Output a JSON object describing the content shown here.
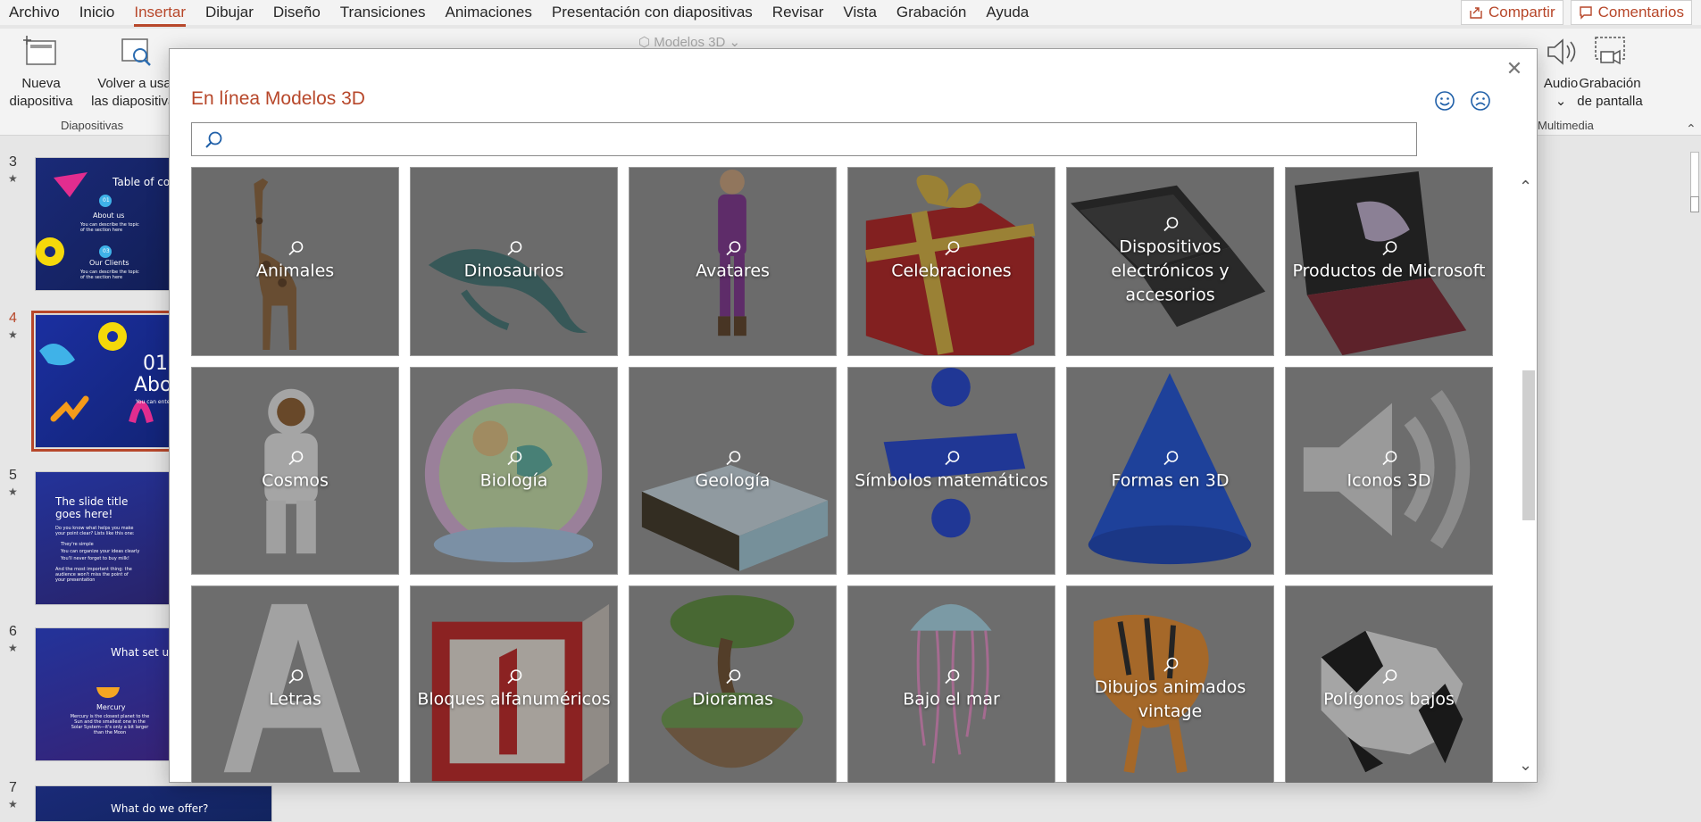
{
  "menu": {
    "items": [
      "Archivo",
      "Inicio",
      "Insertar",
      "Dibujar",
      "Diseño",
      "Transiciones",
      "Animaciones",
      "Presentación con diapositivas",
      "Revisar",
      "Vista",
      "Grabación",
      "Ayuda"
    ],
    "share_label": "Compartir",
    "comments_label": "Comentarios"
  },
  "ribbon": {
    "new_slide_line1": "Nueva",
    "new_slide_line2": "diapositiva",
    "reuse_line1": "Volver a usar",
    "reuse_line2": "las diapositivas",
    "slides_group_label": "Diapositivas",
    "models3d_label": "Modelos 3D",
    "audio_label": "Audio",
    "screen_rec_line1": "Grabación",
    "screen_rec_line2": "de pantalla",
    "multimedia_group_label": "Multimedia"
  },
  "slides": [
    {
      "number": "3",
      "title": "Table of contents",
      "item1": "About us",
      "item1_num": "01",
      "item1_desc": "You can describe the topic of the section here",
      "item2": "Our Clients",
      "item2_num": "03",
      "item2_desc": "You can describe the topic of the section here"
    },
    {
      "number": "4",
      "title_num": "01",
      "title": "About us",
      "subtitle": "You can enter a subtitle here"
    },
    {
      "number": "5",
      "title": "The slide title goes here!",
      "body": "Do you know what helps you make your point clear? Lists like this one:",
      "bullets": [
        "They're simple",
        "You can organize your ideas clearly",
        "You'll never forget to buy milk!"
      ],
      "footer": "And the most important thing: the audience won't miss the point of your presentation"
    },
    {
      "number": "6",
      "title": "What set us apart",
      "label": "Mercury",
      "desc": "Mercury is the closest planet to the Sun and the smallest one in the Solar System—it's only a bit larger than the Moon"
    },
    {
      "number": "7",
      "title": "What do we offer?"
    }
  ],
  "dialog": {
    "title": "En línea Modelos 3D",
    "search_placeholder": "",
    "categories": [
      {
        "label": "Animales",
        "icon": "giraffe-icon"
      },
      {
        "label": "Dinosaurios",
        "icon": "plesiosaur-icon"
      },
      {
        "label": "Avatares",
        "icon": "avatar-icon"
      },
      {
        "label": "Celebraciones",
        "icon": "gift-icon"
      },
      {
        "label": "Dispositivos electrónicos y accesorios",
        "icon": "laptop-icon"
      },
      {
        "label": "Productos de Microsoft",
        "icon": "surface-tablet-icon"
      },
      {
        "label": "Cosmos",
        "icon": "astronaut-icon"
      },
      {
        "label": "Biología",
        "icon": "cell-icon"
      },
      {
        "label": "Geología",
        "icon": "terrain-block-icon"
      },
      {
        "label": "Símbolos matemáticos",
        "icon": "division-sign-icon"
      },
      {
        "label": "Formas en 3D",
        "icon": "cone-icon"
      },
      {
        "label": "Iconos 3D",
        "icon": "speaker-icon"
      },
      {
        "label": "Letras",
        "icon": "letter-a-icon"
      },
      {
        "label": "Bloques alfanuméricos",
        "icon": "number-block-icon"
      },
      {
        "label": "Dioramas",
        "icon": "floating-island-icon"
      },
      {
        "label": "Bajo el mar",
        "icon": "jellyfish-icon"
      },
      {
        "label": "Dibujos animados vintage",
        "icon": "cartoon-tiger-icon"
      },
      {
        "label": "Polígonos bajos",
        "icon": "panda-icon"
      }
    ]
  },
  "colors": {
    "accent": "#b7472a",
    "slide_dark": "#1b2a6b",
    "slide_purple": "#2a1f5e"
  }
}
